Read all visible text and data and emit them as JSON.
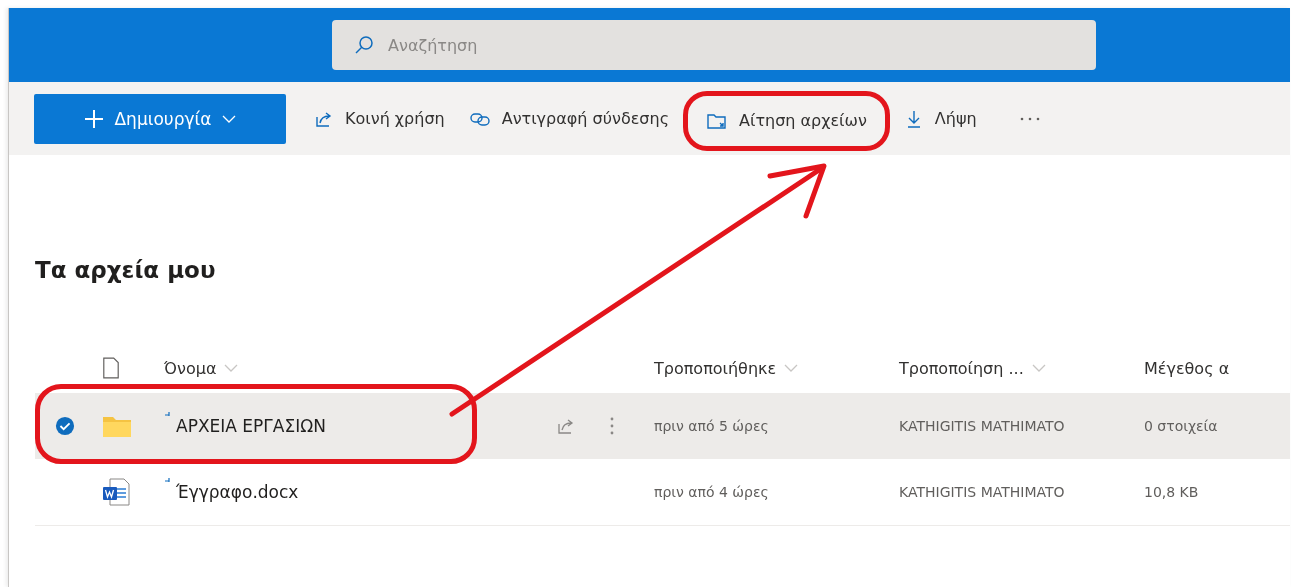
{
  "search": {
    "placeholder": "Αναζήτηση"
  },
  "toolbar": {
    "new_button": {
      "label": "Δημιουργία"
    },
    "items": [
      {
        "kind": "share",
        "label": "Κοινή χρήση",
        "highlighted": false
      },
      {
        "kind": "link",
        "label": "Αντιγραφή σύνδεσης",
        "highlighted": false
      },
      {
        "kind": "request",
        "label": "Αίτηση αρχείων",
        "highlighted": true
      },
      {
        "kind": "download",
        "label": "Λήψη",
        "highlighted": false
      }
    ]
  },
  "page_title": "Τα αρχεία μου",
  "table": {
    "columns": [
      "Όνομα",
      "Τροποποιήθηκε",
      "Τροποποίηση ...",
      "Μέγεθος α"
    ],
    "rows": [
      {
        "kind": "folder",
        "name": "ΑΡΧΕΙΑ ΕΡΓΑΣΙΩΝ",
        "modified": "πριν από 5 ώρες",
        "modified_by": "KATHIGITIS MATHIMATO",
        "size": "0 στοιχεία",
        "selected": true,
        "highlighted": true
      },
      {
        "kind": "word",
        "name": "Έγγραφο.docx",
        "modified": "πριν από 4 ώρες",
        "modified_by": "KATHIGITIS MATHIMATO",
        "size": "10,8 KB",
        "selected": false,
        "highlighted": false
      }
    ]
  }
}
